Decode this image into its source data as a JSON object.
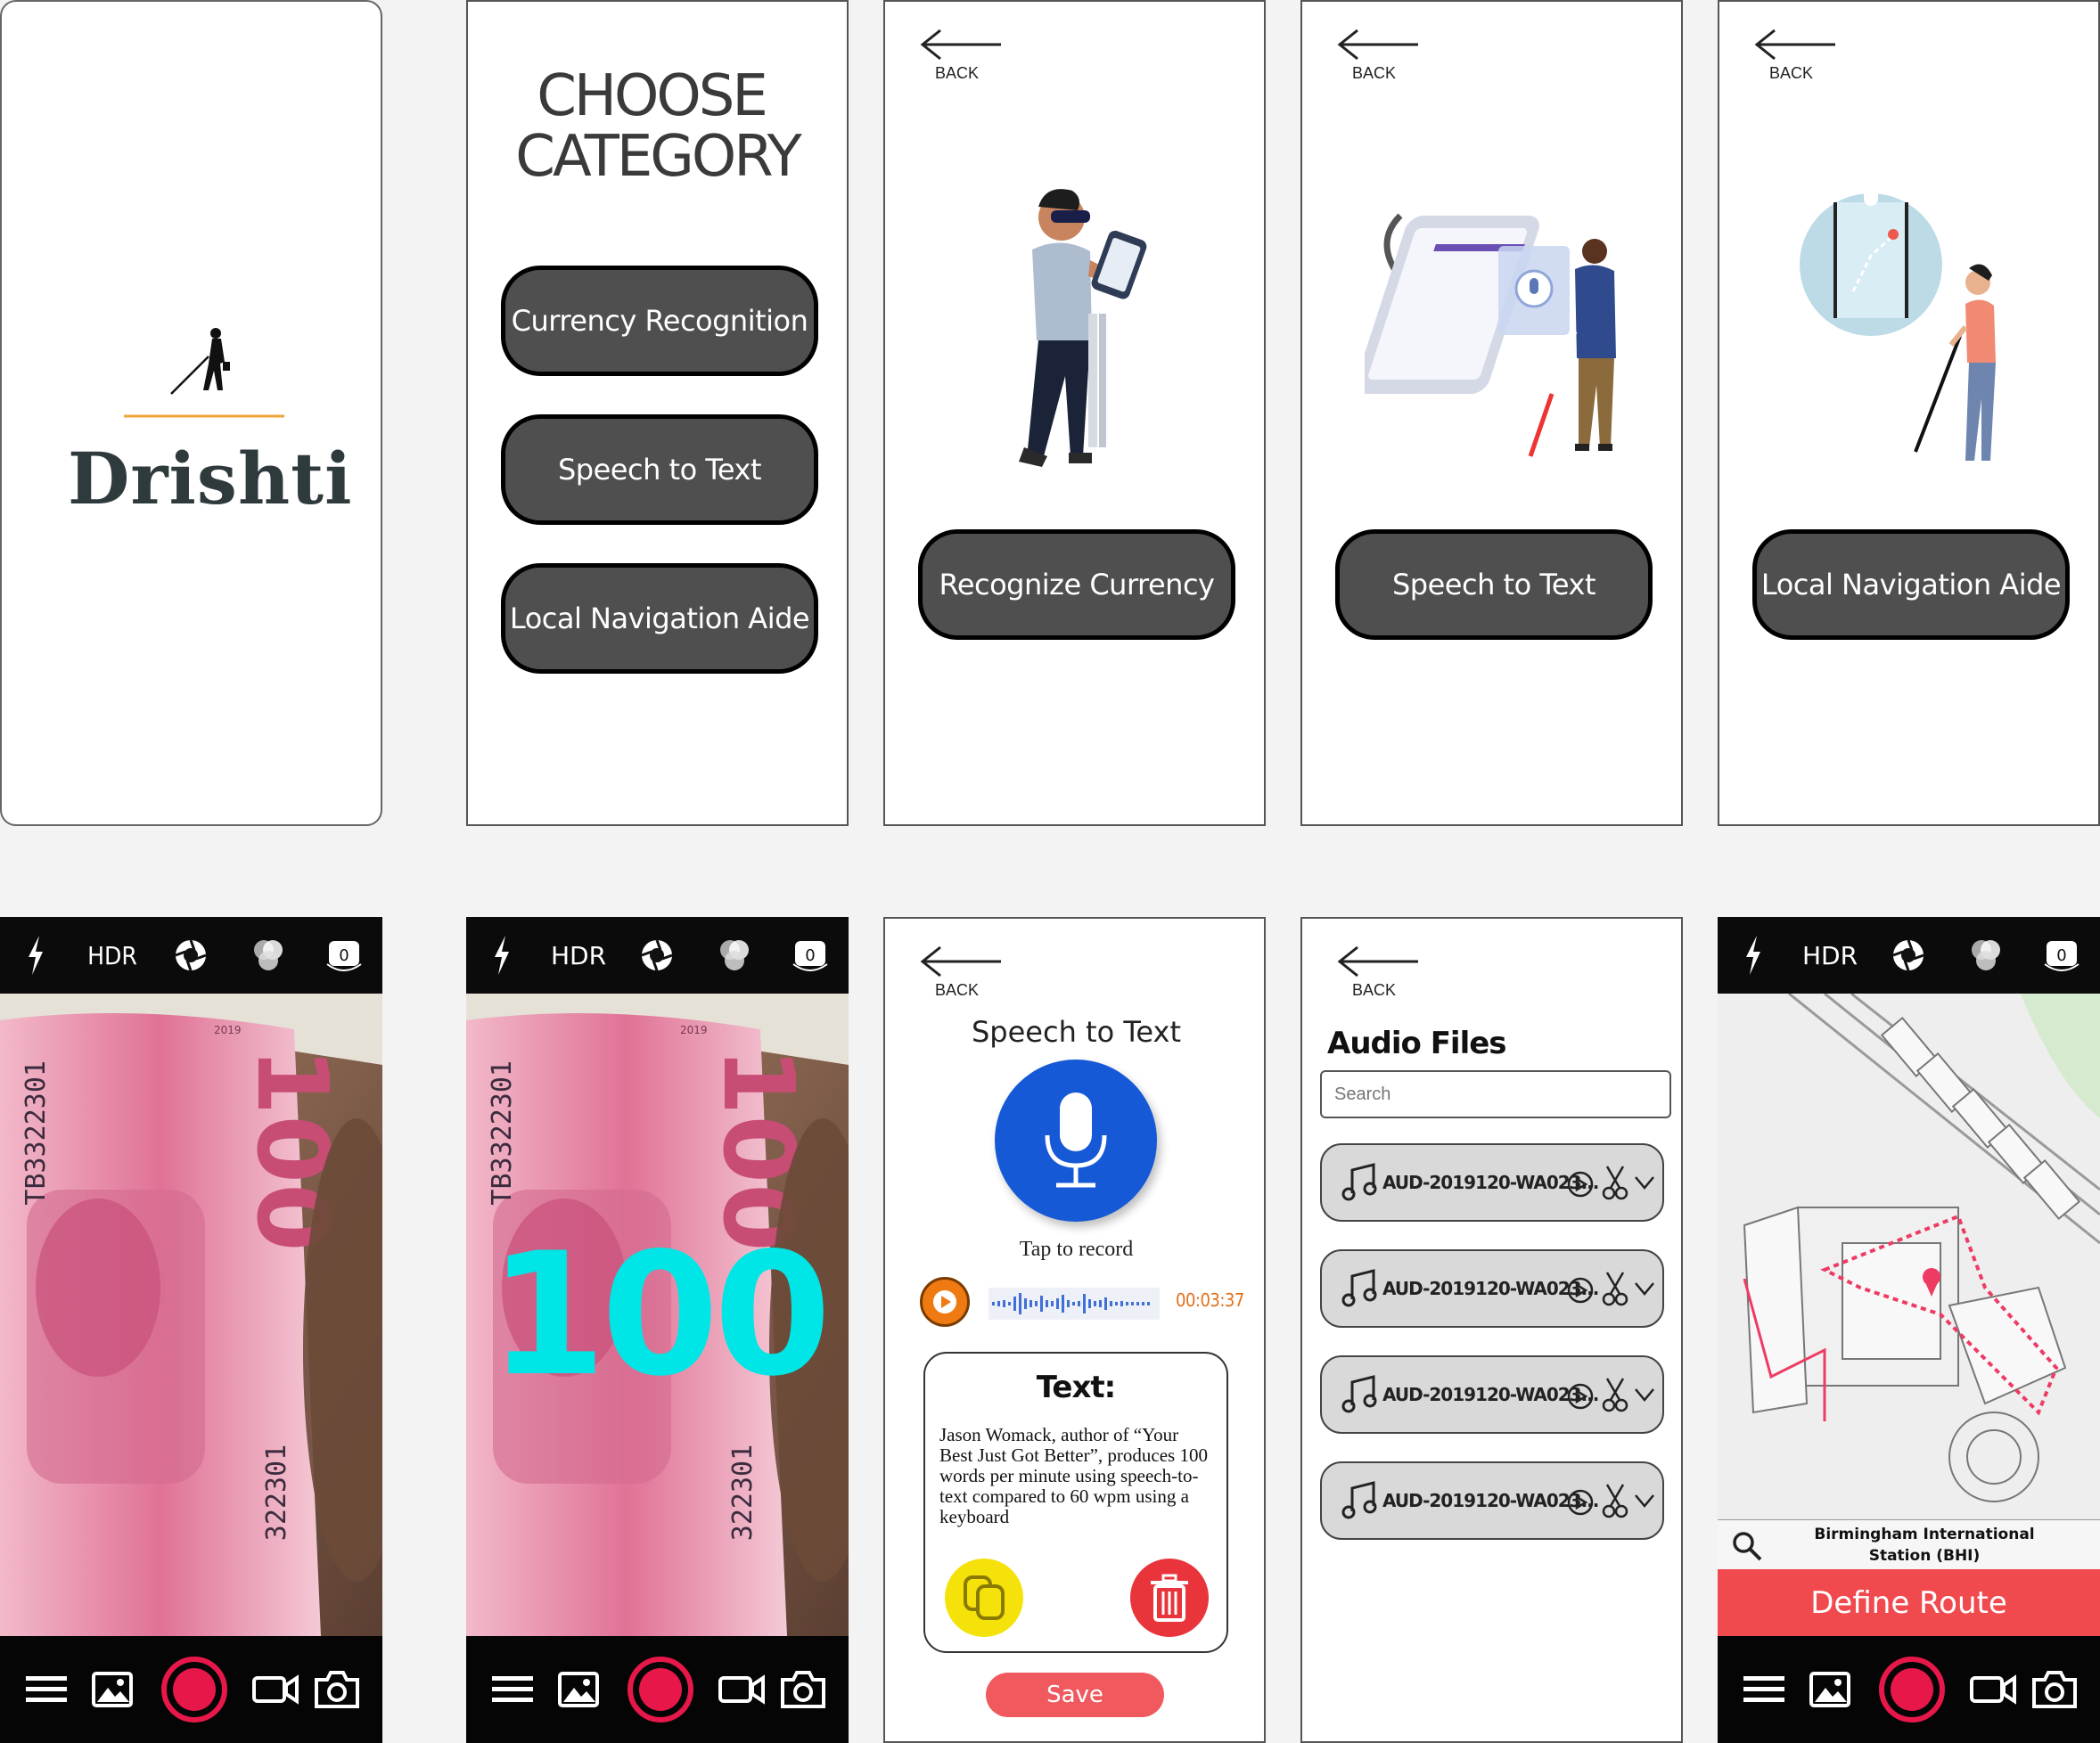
{
  "splash": {
    "app_name": "Drishti"
  },
  "category": {
    "title_line1": "CHOOSE",
    "title_line2": "CATEGORY",
    "buttons": [
      "Currency Recognition",
      "Speech to Text",
      "Local Navigation Aide"
    ]
  },
  "back_label": "BACK",
  "intro_currency": {
    "button": "Recognize Currency"
  },
  "intro_speech": {
    "button": "Speech to Text"
  },
  "intro_nav": {
    "button": "Local Navigation Aide"
  },
  "camera": {
    "hdr": "HDR",
    "timer": "0"
  },
  "currency_result": {
    "value": "100"
  },
  "banknote": {
    "serial": "TB3322301",
    "serial_partial": "322301",
    "denomination": "100",
    "year": "2019"
  },
  "speech": {
    "title": "Speech to Text",
    "tap": "Tap to record",
    "time": "00:03:37",
    "text_heading": "Text:",
    "text_body": "Jason Womack, author of  “Your Best Just Got Better”, produces 100 words per minute using speech-to-text compared to 60 wpm using a keyboard",
    "save": "Save"
  },
  "audio": {
    "title": "Audio Files",
    "search_placeholder": "Search",
    "files": [
      "AUD-2019120-WA023...",
      "AUD-2019120-WA023...",
      "AUD-2019120-WA023...",
      "AUD-2019120-WA023..."
    ]
  },
  "map": {
    "location_line1": "Birmingham International",
    "location_line2": "Station (BHI)",
    "define_route": "Define Route"
  },
  "colors": {
    "accent_red": "#f04a4f",
    "record_ring": "#e8174a",
    "mic_blue": "#1659d6",
    "result_cyan": "#00e6e6",
    "play_orange": "#f07a12"
  }
}
